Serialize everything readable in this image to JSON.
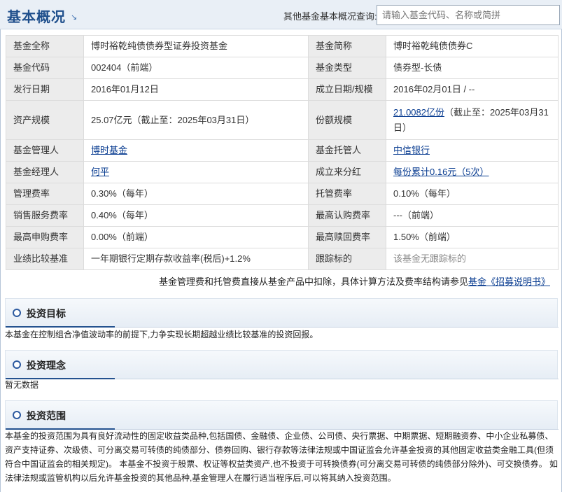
{
  "header": {
    "title": "基本概况",
    "title_arrow_icon": "corner-arrow-icon",
    "query_label": "其他基金基本概况查询:",
    "search_placeholder": "请输入基金代码、名称或简拼"
  },
  "info_rows": [
    {
      "l1": "基金全称",
      "v1": "博时裕乾纯债债券型证券投资基金",
      "l2": "基金简称",
      "v2": "博时裕乾纯债债券C"
    },
    {
      "l1": "基金代码",
      "v1": "002404（前端）",
      "l2": "基金类型",
      "v2": "债券型-长债"
    },
    {
      "l1": "发行日期",
      "v1": "2016年01月12日",
      "l2": "成立日期/规模",
      "v2": "2016年02月01日 / --"
    },
    {
      "l1": "资产规模",
      "v1": "25.07亿元（截止至：2025年03月31日）",
      "l2": "份额规模",
      "v2_link": "21.0082亿份",
      "v2_rest": "（截止至：2025年03月31日）"
    },
    {
      "l1": "基金管理人",
      "v1_link": "博时基金",
      "l2": "基金托管人",
      "v2_link": "中信银行"
    },
    {
      "l1": "基金经理人",
      "v1_link": "何平",
      "l2": "成立来分红",
      "v2_link": "每份累计0.16元（5次）"
    },
    {
      "l1": "管理费率",
      "v1": "0.30%（每年）",
      "l2": "托管费率",
      "v2": "0.10%（每年）"
    },
    {
      "l1": "销售服务费率",
      "v1": "0.40%（每年）",
      "l2": "最高认购费率",
      "v2": "---（前端）"
    },
    {
      "l1": "最高申购费率",
      "v1": "0.00%（前端）",
      "l2": "最高赎回费率",
      "v2": "1.50%（前端）"
    },
    {
      "l1": "业绩比较基准",
      "v1": "一年期银行定期存款收益率(税后)+1.2%",
      "l2": "跟踪标的",
      "v2": "该基金无跟踪标的"
    }
  ],
  "fee_note": {
    "text": "基金管理费和托管费直接从基金产品中扣除，具体计算方法及费率结构请参见",
    "link": "基金《招募说明书》"
  },
  "sections": {
    "objective": {
      "title": "投资目标",
      "body": "本基金在控制组合净值波动率的前提下,力争实现长期超越业绩比较基准的投资回报。"
    },
    "philosophy": {
      "title": "投资理念",
      "body": "暂无数据"
    },
    "scope": {
      "title": "投资范围",
      "body": "本基金的投资范围为具有良好流动性的固定收益类品种,包括国债、金融债、企业债、公司债、央行票据、中期票据、短期融资券、中小企业私募债、资产支持证券、次级债、可分离交易可转债的纯债部分、债券回购、银行存款等法律法规或中国证监会允许基金投资的其他固定收益类金融工具(但须符合中国证监会的相关规定)。 本基金不投资于股票、权证等权益类资产,也不投资于可转换债券(可分离交易可转债的纯债部分除外)、可交换债券。 如法律法规或监管机构以后允许基金投资的其他品种,基金管理人在履行适当程序后,可以将其纳入投资范围。"
    }
  },
  "colors": {
    "header_bg": "#e9eff6",
    "title": "#1f4f8c",
    "link": "#0a3d91",
    "label_bg": "#ececec",
    "accent": "#24528f"
  }
}
